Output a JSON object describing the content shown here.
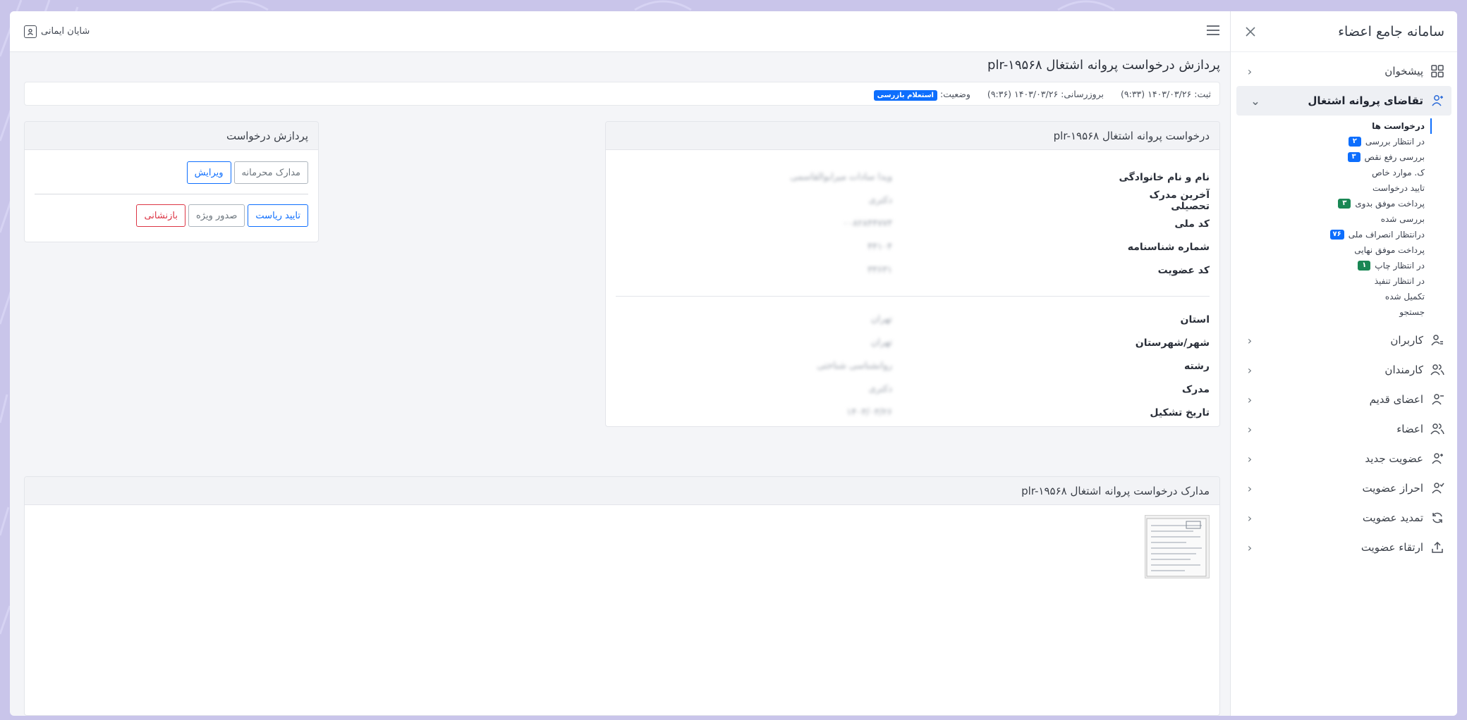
{
  "sidebar": {
    "title": "سامانه جامع اعضاء",
    "menu": [
      {
        "label": "پیشخوان"
      },
      {
        "label": "تقاضای پروانه اشتغال"
      },
      {
        "label": "کاربران"
      },
      {
        "label": "کارمندان"
      },
      {
        "label": "اعضای قدیم"
      },
      {
        "label": "اعضاء"
      },
      {
        "label": "عضویت جدید"
      },
      {
        "label": "احراز عضویت"
      },
      {
        "label": "تمدید عضویت"
      },
      {
        "label": "ارتقاء عضویت"
      }
    ],
    "submenu": [
      {
        "label": "درخواست ها"
      },
      {
        "label": "در انتظار بررسی",
        "badge": "۲"
      },
      {
        "label": "بررسی رفع نقص",
        "badge": "۳"
      },
      {
        "label": "ک. موارد خاص"
      },
      {
        "label": "تایید درخواست"
      },
      {
        "label": "پرداخت موفق بدوی",
        "badge": "۳"
      },
      {
        "label": "بررسی شده"
      },
      {
        "label": "درانتظار انصراف ملی",
        "badge": "۷۶"
      },
      {
        "label": "پرداخت موفق نهایی"
      },
      {
        "label": "در انتظار چاپ",
        "badge": "۱"
      },
      {
        "label": "در انتظار تنفیذ"
      },
      {
        "label": "تکمیل شده"
      },
      {
        "label": "جستجو"
      }
    ]
  },
  "topbar": {
    "user_name": "شایان ایمانی"
  },
  "page": {
    "title": "پردازش درخواست پروانه اشتغال plr-۱۹۵۶۸",
    "registered": "ثبت: ۱۴۰۳/۰۳/۲۶ (۹:۳۳)",
    "updated": "بروزرسانی: ۱۴۰۳/۰۳/۲۶ (۹:۳۶)",
    "status_label": "وضعیت:",
    "status_value": "استعلام بازرسی"
  },
  "details": {
    "header": "درخواست پروانه اشتغال plr-۱۹۵۶۸",
    "group1": [
      {
        "label": "نام و نام خانوادگی",
        "value": "ویدا سادات میرابوالقاسمی"
      },
      {
        "label": "آخرین مدرک تحصیلی",
        "value": "دکتری"
      },
      {
        "label": "کد ملی",
        "value": "۰۰۸۲۸۴۴۷۷۳"
      },
      {
        "label": "شماره شناسنامه",
        "value": "۴۴۱۰۴"
      },
      {
        "label": "کد عضویت",
        "value": "۳۳۶۳۱"
      }
    ],
    "group2": [
      {
        "label": "استان",
        "value": "تهران"
      },
      {
        "label": "شهر/شهرستان",
        "value": "تهران"
      },
      {
        "label": "رشته",
        "value": "روانشناسی شناختی"
      },
      {
        "label": "مدرک",
        "value": "دکتری"
      },
      {
        "label": "تاریخ تشکیل",
        "value": "۱۴۰۳/۰۳/۲۶"
      }
    ]
  },
  "process": {
    "header": "پردازش درخواست",
    "buttons_row1": {
      "confidential": "مدارک محرمانه",
      "edit": "ویرایش"
    },
    "buttons_row2": {
      "approve": "تایید ریاست",
      "special": "صدور ویژه",
      "return": "بازنشانی"
    }
  },
  "documents": {
    "header": "مدارک درخواست پروانه اشتغال plr-۱۹۵۶۸"
  }
}
